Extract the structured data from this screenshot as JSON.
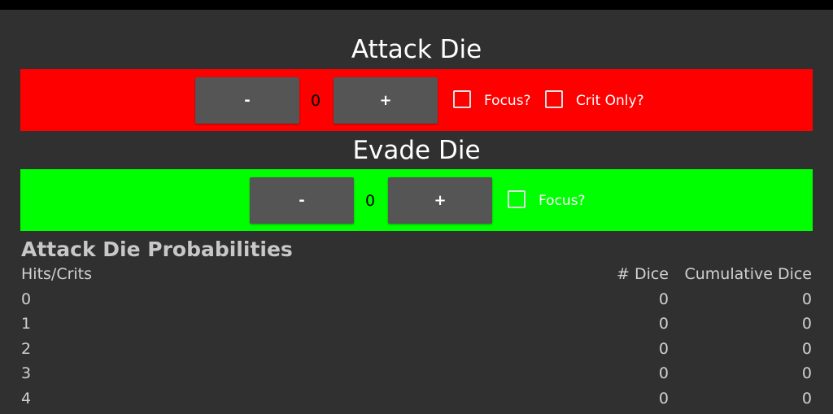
{
  "attack": {
    "title": "Attack Die",
    "minus_label": "-",
    "count": "0",
    "plus_label": "+",
    "focus_label": "Focus?",
    "crit_only_label": "Crit Only?"
  },
  "evade": {
    "title": "Evade Die",
    "minus_label": "-",
    "count": "0",
    "plus_label": "+",
    "focus_label": "Focus?"
  },
  "probabilities": {
    "title": "Attack Die Probabilities",
    "headers": [
      "Hits/Crits",
      "# Dice",
      "Cumulative Dice"
    ],
    "rows": [
      [
        "0",
        "0",
        "0"
      ],
      [
        "1",
        "0",
        "0"
      ],
      [
        "2",
        "0",
        "0"
      ],
      [
        "3",
        "0",
        "0"
      ],
      [
        "4",
        "0",
        "0"
      ]
    ]
  },
  "colors": {
    "attack_band": "#ff0000",
    "evade_band": "#00ff00",
    "background": "#303030",
    "button": "#555555"
  }
}
